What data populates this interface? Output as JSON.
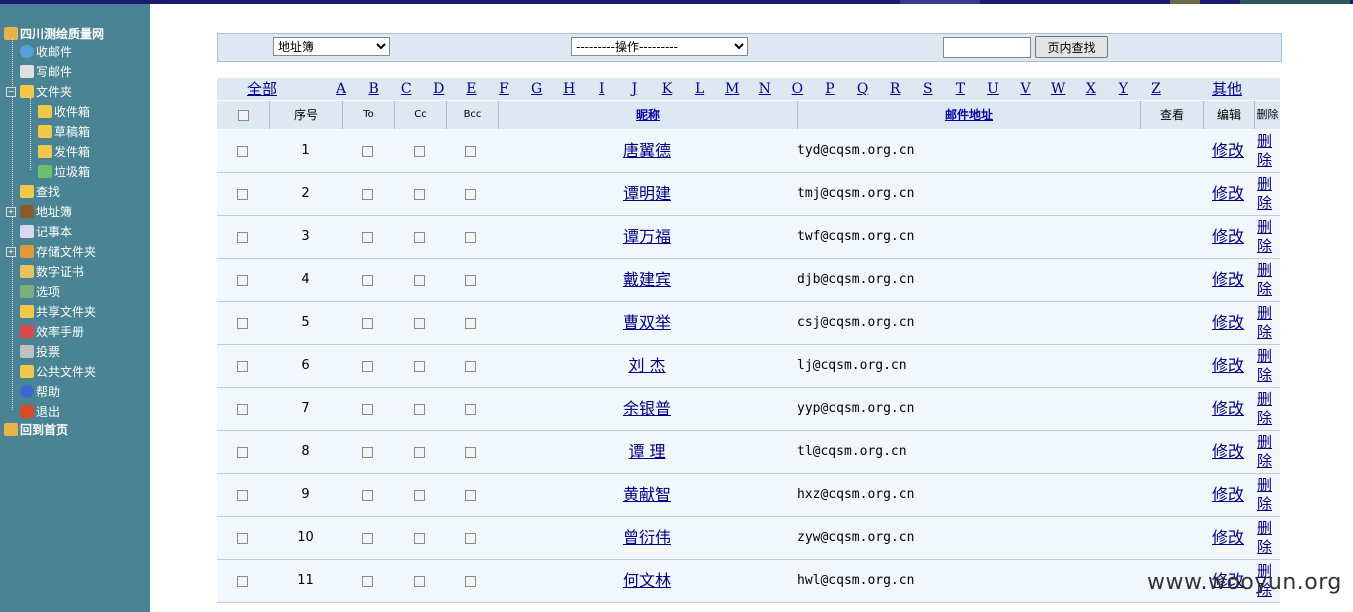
{
  "sidebar": {
    "title": "四川测绘质量网",
    "items": [
      {
        "label": "收邮件",
        "icon": "globe-mail-icon",
        "level": 1
      },
      {
        "label": "写邮件",
        "icon": "write-mail-icon",
        "level": 1
      },
      {
        "label": "文件夹",
        "icon": "folder-icon",
        "level": 1,
        "toggle": "−"
      },
      {
        "label": "收件箱",
        "icon": "folder-icon",
        "level": 2
      },
      {
        "label": "草稿箱",
        "icon": "folder-icon",
        "level": 2
      },
      {
        "label": "发件箱",
        "icon": "folder-icon",
        "level": 2
      },
      {
        "label": "垃圾箱",
        "icon": "trash-icon",
        "level": 2
      },
      {
        "label": "查找",
        "icon": "search-folder-icon",
        "level": 1
      },
      {
        "label": "地址簿",
        "icon": "address-book-icon",
        "level": 1,
        "toggle": "+"
      },
      {
        "label": "记事本",
        "icon": "notepad-icon",
        "level": 1
      },
      {
        "label": "存储文件夹",
        "icon": "storage-icon",
        "level": 1,
        "toggle": "+"
      },
      {
        "label": "数字证书",
        "icon": "certificate-icon",
        "level": 1
      },
      {
        "label": "选项",
        "icon": "options-icon",
        "level": 1
      },
      {
        "label": "共享文件夹",
        "icon": "shared-folder-icon",
        "level": 1
      },
      {
        "label": "效率手册",
        "icon": "handbook-icon",
        "level": 1
      },
      {
        "label": "投票",
        "icon": "vote-icon",
        "level": 1
      },
      {
        "label": "公共文件夹",
        "icon": "public-folder-icon",
        "level": 1
      },
      {
        "label": "帮助",
        "icon": "help-icon",
        "level": 1
      },
      {
        "label": "退出",
        "icon": "exit-icon",
        "level": 1
      }
    ],
    "home": "回到首页"
  },
  "toolbar": {
    "addressbook_select": "地址簿",
    "operation_select": "---------操作---------",
    "search_value": "",
    "search_button": "页内查找"
  },
  "letters": {
    "all": "全部",
    "list": [
      "A",
      "B",
      "C",
      "D",
      "E",
      "F",
      "G",
      "H",
      "I",
      "J",
      "K",
      "L",
      "M",
      "N",
      "O",
      "P",
      "Q",
      "R",
      "S",
      "T",
      "U",
      "V",
      "W",
      "X",
      "Y",
      "Z"
    ],
    "other": "其他"
  },
  "table": {
    "headers": {
      "seq": "序号",
      "to": "To",
      "cc": "Cc",
      "bcc": "Bcc",
      "nickname": "昵称",
      "email": "邮件地址",
      "view": "查看",
      "edit": "编辑",
      "delete": "删除"
    },
    "edit_label": "修改",
    "delete_label": "删\n除",
    "rows": [
      {
        "num": "1",
        "nickname": "唐翼德",
        "email": "tyd@cqsm.org.cn"
      },
      {
        "num": "2",
        "nickname": "谭明建",
        "email": "tmj@cqsm.org.cn"
      },
      {
        "num": "3",
        "nickname": "谭万福",
        "email": "twf@cqsm.org.cn"
      },
      {
        "num": "4",
        "nickname": "戴建宾",
        "email": "djb@cqsm.org.cn"
      },
      {
        "num": "5",
        "nickname": "曹双举",
        "email": "csj@cqsm.org.cn"
      },
      {
        "num": "6",
        "nickname": "刘 杰",
        "email": "lj@cqsm.org.cn"
      },
      {
        "num": "7",
        "nickname": "余银普",
        "email": "yyp@cqsm.org.cn"
      },
      {
        "num": "8",
        "nickname": "谭 理",
        "email": "tl@cqsm.org.cn"
      },
      {
        "num": "9",
        "nickname": "黄献智",
        "email": "hxz@cqsm.org.cn"
      },
      {
        "num": "10",
        "nickname": "曾衍伟",
        "email": "zyw@cqsm.org.cn"
      },
      {
        "num": "11",
        "nickname": "何文林",
        "email": "hwl@cqsm.org.cn"
      }
    ]
  },
  "watermark": "www.wooyun.org"
}
